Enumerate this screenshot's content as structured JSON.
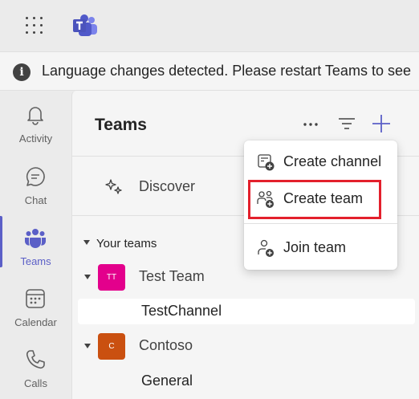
{
  "banner": {
    "text": "Language changes detected. Please restart Teams to see"
  },
  "rail": {
    "items": [
      {
        "label": "Activity",
        "icon": "bell-icon"
      },
      {
        "label": "Chat",
        "icon": "chat-icon"
      },
      {
        "label": "Teams",
        "icon": "teams-icon",
        "active": true
      },
      {
        "label": "Calendar",
        "icon": "calendar-icon"
      },
      {
        "label": "Calls",
        "icon": "phone-icon"
      }
    ]
  },
  "panel": {
    "title": "Teams",
    "discover_label": "Discover",
    "section_label": "Your teams",
    "teams": [
      {
        "name": "Test Team",
        "initials": "TT",
        "color": "#e3008c",
        "channels": [
          "TestChannel"
        ]
      },
      {
        "name": "Contoso",
        "initials": "C",
        "color": "#ca5010",
        "channels": [
          "General"
        ]
      }
    ]
  },
  "menu": {
    "items": [
      {
        "label": "Create channel",
        "icon": "create-channel-icon"
      },
      {
        "label": "Create team",
        "icon": "create-team-icon",
        "highlighted": true
      },
      {
        "label": "Join team",
        "icon": "join-team-icon"
      }
    ]
  },
  "colors": {
    "accent": "#5b5fc7",
    "highlight": "#e3202c"
  }
}
